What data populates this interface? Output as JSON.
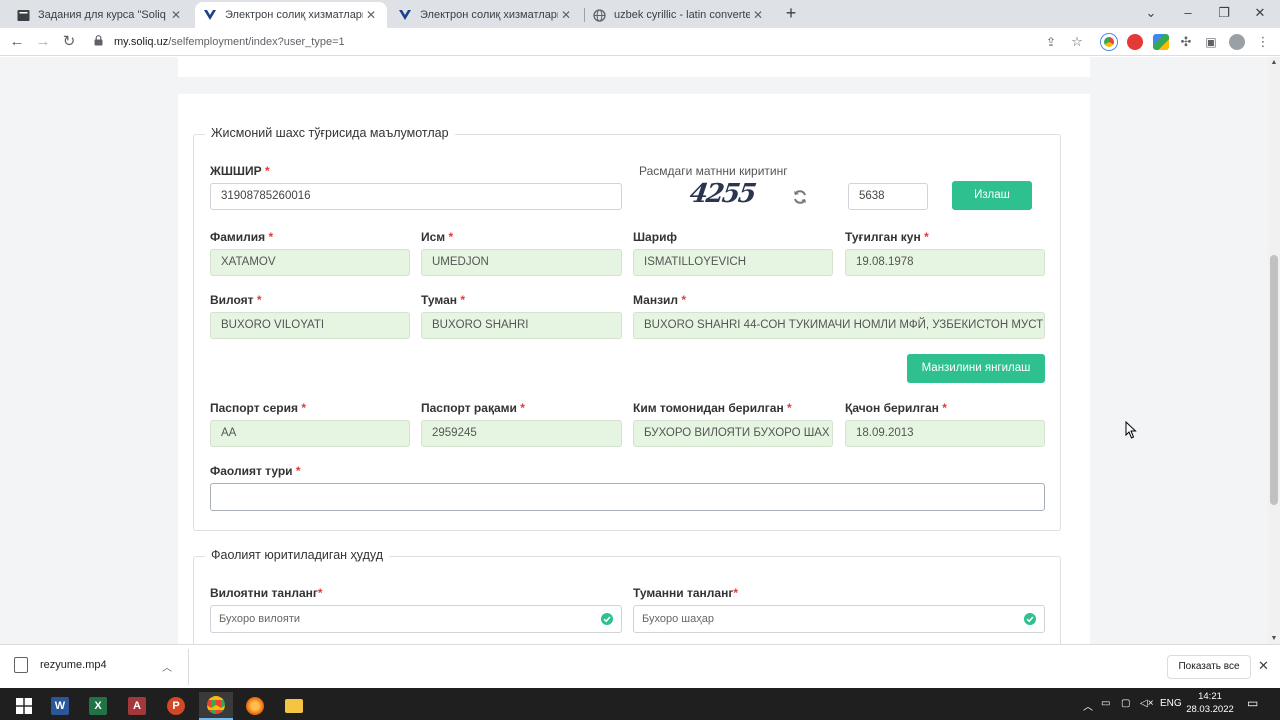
{
  "browser": {
    "tabs": [
      {
        "title": "Задания для курса \"Soliq sohasi",
        "favicon": "course-icon"
      },
      {
        "title": "Электрон солиқ хизматлари",
        "favicon": "soliq-icon",
        "active": true
      },
      {
        "title": "Электрон солиқ хизматлари",
        "favicon": "soliq-icon"
      },
      {
        "title": "uzbek cyrillic - latin converter. Тр",
        "favicon": "globe-icon"
      }
    ],
    "url_host": "my.soliq.uz",
    "url_path": "/selfemployment/index?user_type=1"
  },
  "section1": {
    "legend": "Жисмоний шахс тўғрисида маълумотлар",
    "jshshir": {
      "label": "ЖШШИР",
      "value": "31908785260016"
    },
    "captcha": {
      "label": "Расмдаги матнни киритинг",
      "image_text": "4255",
      "input_value": "5638"
    },
    "search_button": "Излаш",
    "surname": {
      "label": "Фамилия",
      "value": "XATAMOV"
    },
    "name": {
      "label": "Исм",
      "value": "UMEDJON"
    },
    "patronymic": {
      "label": "Шариф",
      "value": "ISMATILLOYEVICH"
    },
    "birth_date": {
      "label": "Туғилган кун",
      "value": "19.08.1978"
    },
    "region": {
      "label": "Вилоят",
      "value": "BUXORO VILOYATI"
    },
    "district": {
      "label": "Туман",
      "value": "BUXORO SHAHRI"
    },
    "address": {
      "label": "Манзил",
      "value": "BUXORO SHAHRI 44-СОН ТУКИМАЧИ НОМЛИ МФЙ, УЗБЕКИСТОН МУСТ"
    },
    "update_address_button": "Манзилини янгилаш",
    "passport_series": {
      "label": "Паспорт серия",
      "value": "AA"
    },
    "passport_number": {
      "label": "Паспорт рақами",
      "value": "2959245"
    },
    "issued_by": {
      "label": "Ким томонидан берилган",
      "value": "БУХОРО ВИЛОЯТИ БУХОРО ШАХ"
    },
    "issue_date": {
      "label": "Қачон берилган",
      "value": "18.09.2013"
    },
    "activity_type": {
      "label": "Фаолият тури",
      "value": ""
    },
    "required_mark": "*"
  },
  "section2": {
    "legend": "Фаолият юритиладиган ҳудуд",
    "region_select": {
      "label": "Вилоятни танланг",
      "value": "Бухоро вилояти"
    },
    "district_select": {
      "label": "Туманни танланг",
      "value": "Бухоро шаҳар"
    }
  },
  "downloads": {
    "file": "rezyume.mp4",
    "show_all": "Показать все"
  },
  "taskbar": {
    "language": "ENG",
    "time": "14:21",
    "date": "28.03.2022"
  },
  "colors": {
    "accent_green": "#2ec08f",
    "filled_input_bg": "#e6f5e1",
    "required_red": "#e53935"
  }
}
